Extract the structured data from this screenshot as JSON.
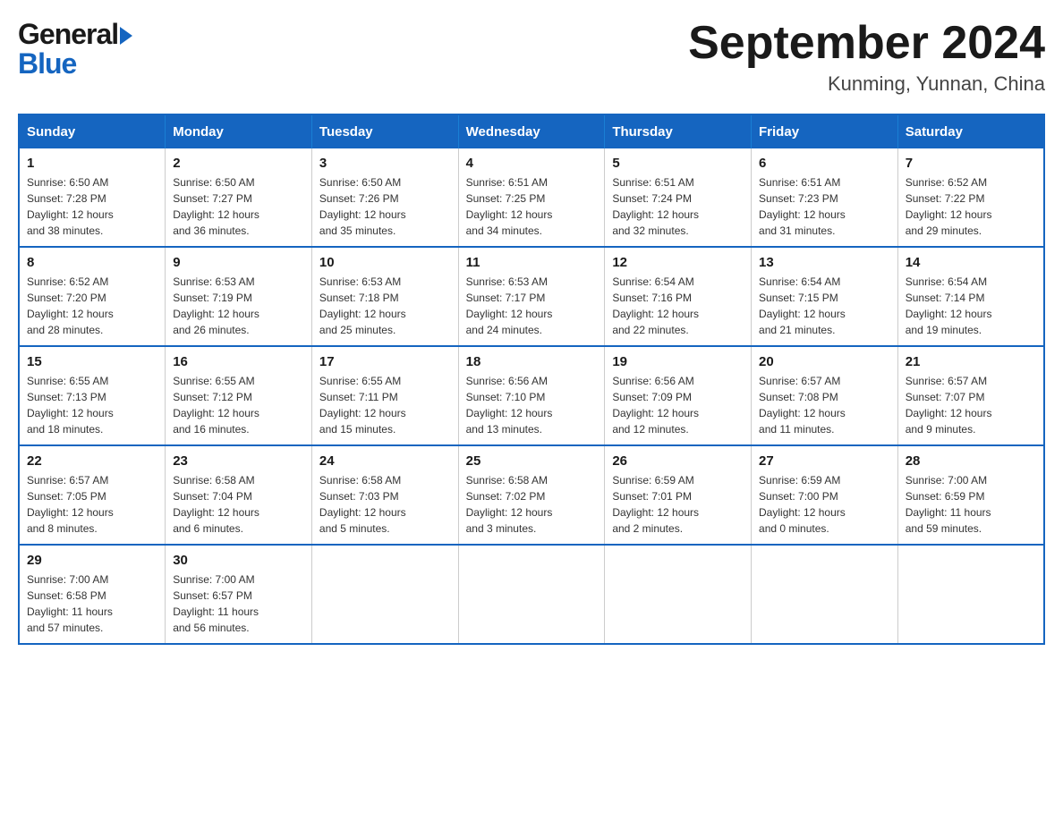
{
  "header": {
    "logo_general": "General",
    "logo_blue": "Blue",
    "title": "September 2024",
    "subtitle": "Kunming, Yunnan, China"
  },
  "weekdays": [
    "Sunday",
    "Monday",
    "Tuesday",
    "Wednesday",
    "Thursday",
    "Friday",
    "Saturday"
  ],
  "weeks": [
    [
      {
        "day": "1",
        "sunrise": "6:50 AM",
        "sunset": "7:28 PM",
        "daylight": "12 hours and 38 minutes."
      },
      {
        "day": "2",
        "sunrise": "6:50 AM",
        "sunset": "7:27 PM",
        "daylight": "12 hours and 36 minutes."
      },
      {
        "day": "3",
        "sunrise": "6:50 AM",
        "sunset": "7:26 PM",
        "daylight": "12 hours and 35 minutes."
      },
      {
        "day": "4",
        "sunrise": "6:51 AM",
        "sunset": "7:25 PM",
        "daylight": "12 hours and 34 minutes."
      },
      {
        "day": "5",
        "sunrise": "6:51 AM",
        "sunset": "7:24 PM",
        "daylight": "12 hours and 32 minutes."
      },
      {
        "day": "6",
        "sunrise": "6:51 AM",
        "sunset": "7:23 PM",
        "daylight": "12 hours and 31 minutes."
      },
      {
        "day": "7",
        "sunrise": "6:52 AM",
        "sunset": "7:22 PM",
        "daylight": "12 hours and 29 minutes."
      }
    ],
    [
      {
        "day": "8",
        "sunrise": "6:52 AM",
        "sunset": "7:20 PM",
        "daylight": "12 hours and 28 minutes."
      },
      {
        "day": "9",
        "sunrise": "6:53 AM",
        "sunset": "7:19 PM",
        "daylight": "12 hours and 26 minutes."
      },
      {
        "day": "10",
        "sunrise": "6:53 AM",
        "sunset": "7:18 PM",
        "daylight": "12 hours and 25 minutes."
      },
      {
        "day": "11",
        "sunrise": "6:53 AM",
        "sunset": "7:17 PM",
        "daylight": "12 hours and 24 minutes."
      },
      {
        "day": "12",
        "sunrise": "6:54 AM",
        "sunset": "7:16 PM",
        "daylight": "12 hours and 22 minutes."
      },
      {
        "day": "13",
        "sunrise": "6:54 AM",
        "sunset": "7:15 PM",
        "daylight": "12 hours and 21 minutes."
      },
      {
        "day": "14",
        "sunrise": "6:54 AM",
        "sunset": "7:14 PM",
        "daylight": "12 hours and 19 minutes."
      }
    ],
    [
      {
        "day": "15",
        "sunrise": "6:55 AM",
        "sunset": "7:13 PM",
        "daylight": "12 hours and 18 minutes."
      },
      {
        "day": "16",
        "sunrise": "6:55 AM",
        "sunset": "7:12 PM",
        "daylight": "12 hours and 16 minutes."
      },
      {
        "day": "17",
        "sunrise": "6:55 AM",
        "sunset": "7:11 PM",
        "daylight": "12 hours and 15 minutes."
      },
      {
        "day": "18",
        "sunrise": "6:56 AM",
        "sunset": "7:10 PM",
        "daylight": "12 hours and 13 minutes."
      },
      {
        "day": "19",
        "sunrise": "6:56 AM",
        "sunset": "7:09 PM",
        "daylight": "12 hours and 12 minutes."
      },
      {
        "day": "20",
        "sunrise": "6:57 AM",
        "sunset": "7:08 PM",
        "daylight": "12 hours and 11 minutes."
      },
      {
        "day": "21",
        "sunrise": "6:57 AM",
        "sunset": "7:07 PM",
        "daylight": "12 hours and 9 minutes."
      }
    ],
    [
      {
        "day": "22",
        "sunrise": "6:57 AM",
        "sunset": "7:05 PM",
        "daylight": "12 hours and 8 minutes."
      },
      {
        "day": "23",
        "sunrise": "6:58 AM",
        "sunset": "7:04 PM",
        "daylight": "12 hours and 6 minutes."
      },
      {
        "day": "24",
        "sunrise": "6:58 AM",
        "sunset": "7:03 PM",
        "daylight": "12 hours and 5 minutes."
      },
      {
        "day": "25",
        "sunrise": "6:58 AM",
        "sunset": "7:02 PM",
        "daylight": "12 hours and 3 minutes."
      },
      {
        "day": "26",
        "sunrise": "6:59 AM",
        "sunset": "7:01 PM",
        "daylight": "12 hours and 2 minutes."
      },
      {
        "day": "27",
        "sunrise": "6:59 AM",
        "sunset": "7:00 PM",
        "daylight": "12 hours and 0 minutes."
      },
      {
        "day": "28",
        "sunrise": "7:00 AM",
        "sunset": "6:59 PM",
        "daylight": "11 hours and 59 minutes."
      }
    ],
    [
      {
        "day": "29",
        "sunrise": "7:00 AM",
        "sunset": "6:58 PM",
        "daylight": "11 hours and 57 minutes."
      },
      {
        "day": "30",
        "sunrise": "7:00 AM",
        "sunset": "6:57 PM",
        "daylight": "11 hours and 56 minutes."
      },
      null,
      null,
      null,
      null,
      null
    ]
  ],
  "labels": {
    "sunrise": "Sunrise:",
    "sunset": "Sunset:",
    "daylight": "Daylight:"
  }
}
